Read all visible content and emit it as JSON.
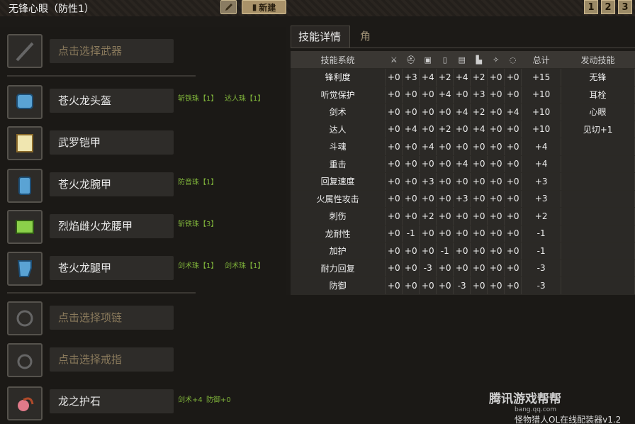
{
  "header": {
    "title": "无锋心眼（防性1）",
    "new_label": "新建",
    "pages": [
      "1",
      "2",
      "3"
    ]
  },
  "tabs": [
    "技能详情",
    "角色信息"
  ],
  "equipment": [
    {
      "name": "点击选择武器",
      "empty": true,
      "jewels": []
    },
    {
      "name": "苍火龙头盔",
      "empty": false,
      "jewels": [
        "斩铁珠【1】",
        "达人珠【1】"
      ]
    },
    {
      "name": "武罗铠甲",
      "empty": false,
      "jewels": []
    },
    {
      "name": "苍火龙腕甲",
      "empty": false,
      "jewels": [
        "防音珠【1】"
      ]
    },
    {
      "name": "烈焰雌火龙腰甲",
      "empty": false,
      "jewels": [
        "斩铁珠【3】"
      ]
    },
    {
      "name": "苍火龙腿甲",
      "empty": false,
      "jewels": [
        "剑术珠【1】",
        "剑术珠【1】"
      ]
    },
    {
      "name": "点击选择项链",
      "empty": true,
      "jewels": []
    },
    {
      "name": "点击选择戒指",
      "empty": true,
      "jewels": []
    },
    {
      "name": "龙之护石",
      "empty": false,
      "jewels": [
        "剑术+4",
        "防御+0"
      ]
    }
  ],
  "table": {
    "headers": [
      "技能系统",
      "",
      "",
      "",
      "",
      "",
      "",
      "",
      "",
      "总计",
      "发动技能"
    ],
    "rows": [
      {
        "skill": "锋利度",
        "vals": [
          "+0",
          "+3",
          "+4",
          "+2",
          "+4",
          "+2",
          "+0",
          "+0"
        ],
        "total": "+15",
        "active": "无锋"
      },
      {
        "skill": "听觉保护",
        "vals": [
          "+0",
          "+0",
          "+0",
          "+4",
          "+0",
          "+3",
          "+0",
          "+0"
        ],
        "total": "+10",
        "active": "耳栓"
      },
      {
        "skill": "剑术",
        "vals": [
          "+0",
          "+0",
          "+0",
          "+0",
          "+4",
          "+2",
          "+0",
          "+4"
        ],
        "total": "+10",
        "active": "心眼"
      },
      {
        "skill": "达人",
        "vals": [
          "+0",
          "+4",
          "+0",
          "+2",
          "+0",
          "+4",
          "+0",
          "+0"
        ],
        "total": "+10",
        "active": "见切+1"
      },
      {
        "skill": "斗魂",
        "vals": [
          "+0",
          "+0",
          "+4",
          "+0",
          "+0",
          "+0",
          "+0",
          "+0"
        ],
        "total": "+4",
        "active": ""
      },
      {
        "skill": "重击",
        "vals": [
          "+0",
          "+0",
          "+0",
          "+0",
          "+4",
          "+0",
          "+0",
          "+0"
        ],
        "total": "+4",
        "active": ""
      },
      {
        "skill": "回复速度",
        "vals": [
          "+0",
          "+0",
          "+3",
          "+0",
          "+0",
          "+0",
          "+0",
          "+0"
        ],
        "total": "+3",
        "active": ""
      },
      {
        "skill": "火属性攻击",
        "vals": [
          "+0",
          "+0",
          "+0",
          "+0",
          "+3",
          "+0",
          "+0",
          "+0"
        ],
        "total": "+3",
        "active": ""
      },
      {
        "skill": "刺伤",
        "vals": [
          "+0",
          "+0",
          "+2",
          "+0",
          "+0",
          "+0",
          "+0",
          "+0"
        ],
        "total": "+2",
        "active": ""
      },
      {
        "skill": "龙耐性",
        "vals": [
          "+0",
          "-1",
          "+0",
          "+0",
          "+0",
          "+0",
          "+0",
          "+0"
        ],
        "total": "-1",
        "active": ""
      },
      {
        "skill": "加护",
        "vals": [
          "+0",
          "+0",
          "+0",
          "-1",
          "+0",
          "+0",
          "+0",
          "+0"
        ],
        "total": "-1",
        "active": ""
      },
      {
        "skill": "耐力回复",
        "vals": [
          "+0",
          "+0",
          "-3",
          "+0",
          "+0",
          "+0",
          "+0",
          "+0"
        ],
        "total": "-3",
        "active": ""
      },
      {
        "skill": "防御",
        "vals": [
          "+0",
          "+0",
          "+0",
          "+0",
          "-3",
          "+0",
          "+0",
          "+0"
        ],
        "total": "-3",
        "active": ""
      }
    ]
  },
  "watermark": {
    "brand": "腾讯游戏帮帮",
    "site": "bang.qq.com",
    "app": "怪物猎人OL在线配装器v1.2"
  },
  "colors": {
    "accent": "#a99269",
    "jewel": "#7fb33a"
  },
  "icons": [
    "weapon-icon",
    "helmet-icon",
    "chest-icon",
    "arm-icon",
    "waist-icon",
    "leg-icon",
    "charm-icon",
    "necklace-icon",
    "ring-icon"
  ]
}
